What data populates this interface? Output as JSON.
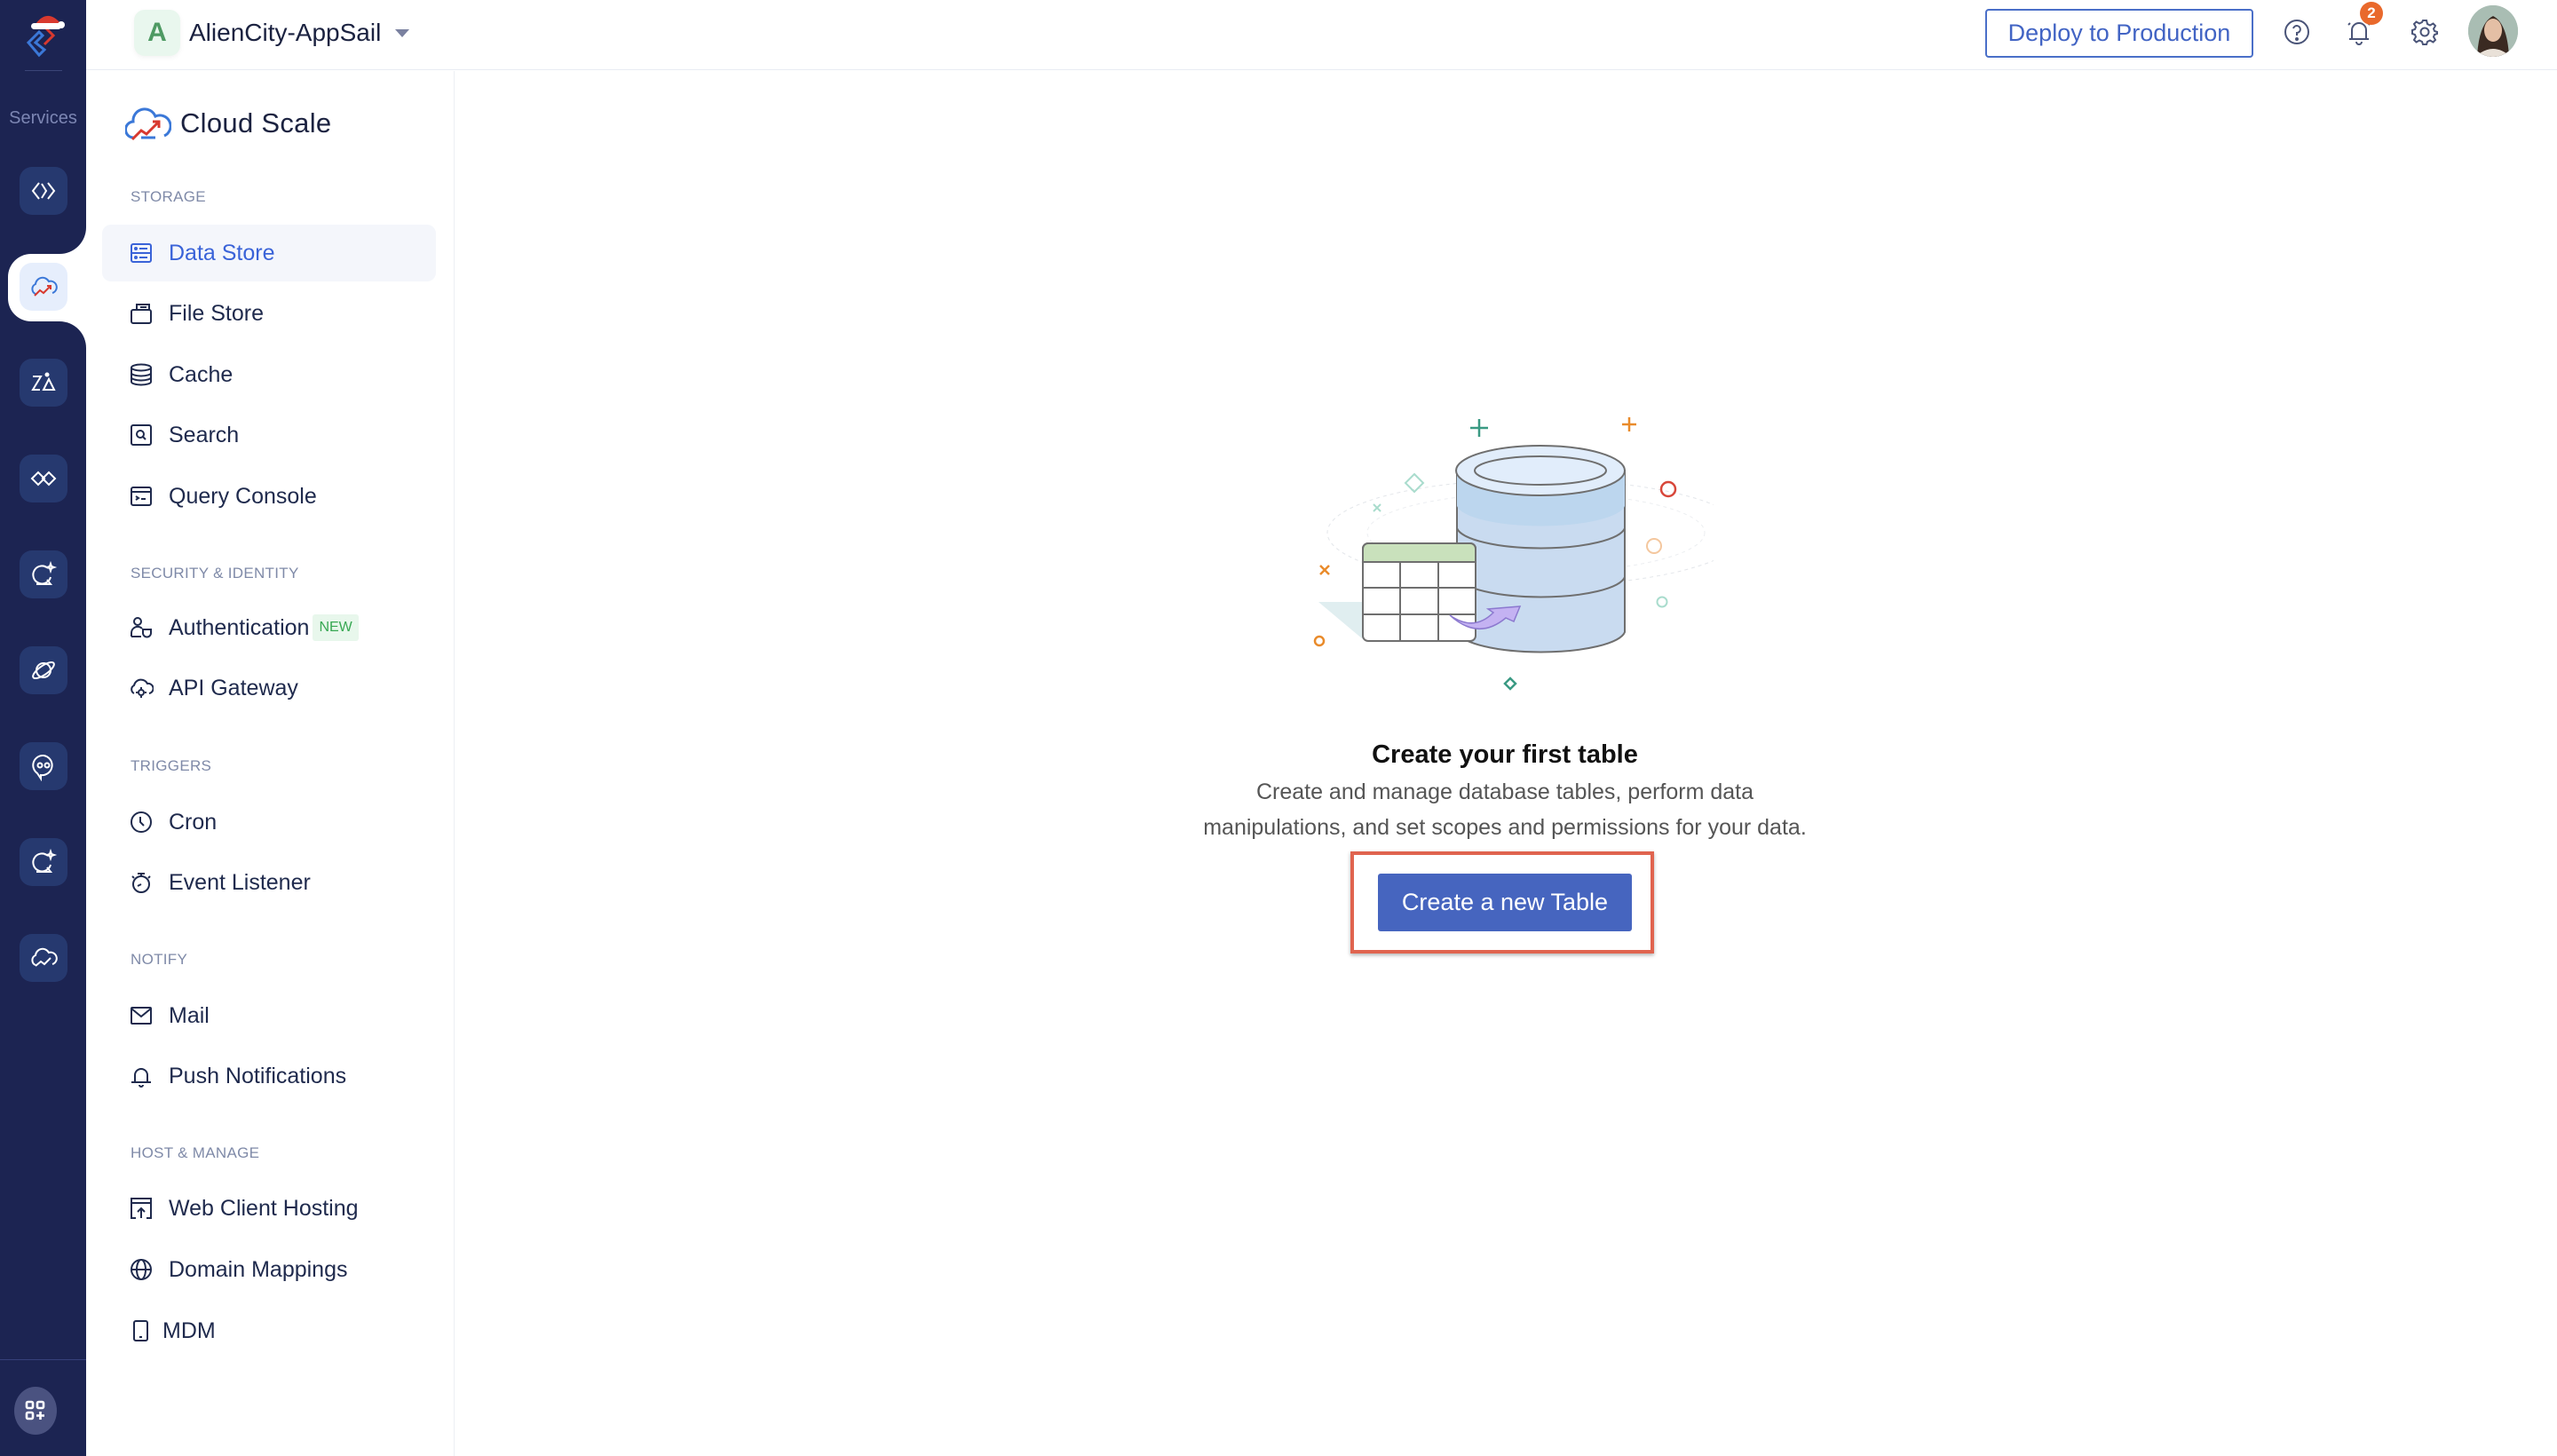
{
  "rail": {
    "services_label": "Services",
    "items": [
      {
        "name": "code-service",
        "active": false
      },
      {
        "name": "cloud-scale",
        "active": true
      },
      {
        "name": "zia",
        "active": false
      },
      {
        "name": "integrations",
        "active": false
      },
      {
        "name": "quickml",
        "active": false
      },
      {
        "name": "devops",
        "active": false
      },
      {
        "name": "smartbrowz",
        "active": false
      },
      {
        "name": "signals",
        "active": false
      },
      {
        "name": "cloud-scale-alt",
        "active": false
      }
    ]
  },
  "header": {
    "app_initial": "A",
    "app_name": "AlienCity-AppSail",
    "deploy_label": "Deploy to Production",
    "notification_count": "2",
    "icons": [
      "help-icon",
      "bell-icon",
      "gear-icon",
      "avatar"
    ]
  },
  "subnav": {
    "title": "Cloud Scale",
    "sections": [
      {
        "label": "STORAGE",
        "items": [
          {
            "label": "Data Store",
            "icon": "data-store-icon",
            "active": true
          },
          {
            "label": "File Store",
            "icon": "file-store-icon"
          },
          {
            "label": "Cache",
            "icon": "cache-icon"
          },
          {
            "label": "Search",
            "icon": "search-icon"
          },
          {
            "label": "Query Console",
            "icon": "console-icon"
          }
        ]
      },
      {
        "label": "SECURITY & IDENTITY",
        "items": [
          {
            "label": "Authentication",
            "icon": "user-shield-icon",
            "badge": "NEW"
          },
          {
            "label": "API Gateway",
            "icon": "cloud-gear-icon"
          }
        ]
      },
      {
        "label": "TRIGGERS",
        "items": [
          {
            "label": "Cron",
            "icon": "clock-icon"
          },
          {
            "label": "Event Listener",
            "icon": "stopwatch-icon"
          }
        ]
      },
      {
        "label": "NOTIFY",
        "items": [
          {
            "label": "Mail",
            "icon": "mail-icon"
          },
          {
            "label": "Push Notifications",
            "icon": "bell-icon"
          }
        ]
      },
      {
        "label": "HOST & MANAGE",
        "items": [
          {
            "label": "Web Client Hosting",
            "icon": "upload-window-icon"
          },
          {
            "label": "Domain Mappings",
            "icon": "globe-icon"
          },
          {
            "label": "MDM",
            "icon": "mobile-icon"
          }
        ]
      }
    ]
  },
  "main": {
    "empty_title": "Create your first table",
    "empty_desc_line1": "Create and manage database tables, perform data",
    "empty_desc_line2": "manipulations, and set scopes and permissions for your data.",
    "create_button": "Create a new Table"
  },
  "colors": {
    "rail_bg": "#1c2452",
    "accent": "#4665bf",
    "active_text": "#3a63d8",
    "highlight": "#e0644f",
    "badge": "#e9692c",
    "new_tag": "#38a853"
  }
}
